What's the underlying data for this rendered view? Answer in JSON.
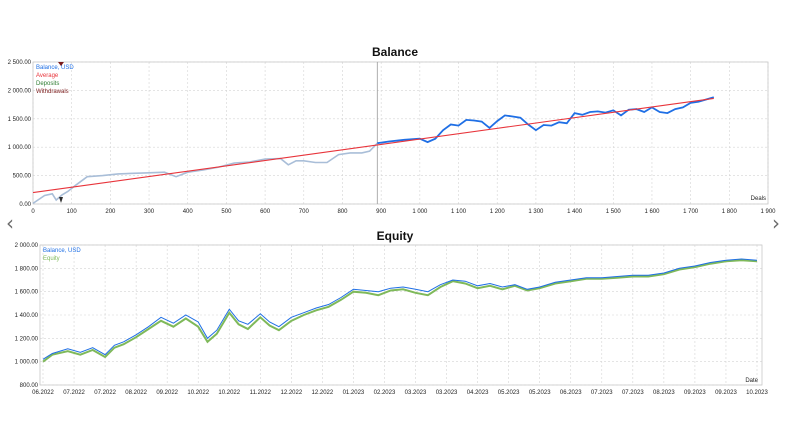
{
  "nav": {
    "prev_label": "‹",
    "next_label": "›"
  },
  "colors": {
    "balance": "#1f6fe5",
    "balance_faded": "#a9bed8",
    "average": "#e8343b",
    "equity": "#7fb95a",
    "withdrawal_marker": "#7a1a1a",
    "deposit_marker": "#2e7d32"
  },
  "chart_data": [
    {
      "type": "line",
      "title": "Balance",
      "xlabel": "Deals",
      "ylabel": "",
      "xlim": [
        0,
        1900
      ],
      "ylim": [
        0,
        2500
      ],
      "x_ticks": [
        "0",
        "100",
        "200",
        "300",
        "400",
        "500",
        "600",
        "700",
        "800",
        "900",
        "1 000",
        "1 100",
        "1 200",
        "1 300",
        "1 400",
        "1 500",
        "1 600",
        "1 700",
        "1 800",
        "1 900"
      ],
      "y_ticks": [
        "0.00",
        "500.00",
        "1 000.00",
        "1 500.00",
        "2 000.00",
        "2 500.00"
      ],
      "grid": true,
      "legend_position": "top-left",
      "legend": [
        "Balance, USD",
        "Average",
        "Deposits",
        "Withdrawals"
      ],
      "divider_x": 890,
      "series": [
        {
          "name": "Balance, USD",
          "x": [
            0,
            30,
            50,
            60,
            75,
            90,
            110,
            140,
            180,
            220,
            260,
            300,
            340,
            370,
            400,
            440,
            480,
            520,
            560,
            600,
            640,
            660,
            680,
            700,
            730,
            760,
            790,
            820,
            850,
            870,
            890,
            920,
            960,
            1000,
            1020,
            1040,
            1060,
            1080,
            1100,
            1120,
            1140,
            1160,
            1180,
            1200,
            1220,
            1240,
            1260,
            1280,
            1300,
            1320,
            1340,
            1360,
            1380,
            1400,
            1420,
            1440,
            1460,
            1480,
            1500,
            1520,
            1540,
            1560,
            1580,
            1600,
            1620,
            1640,
            1660,
            1680,
            1700,
            1720,
            1740,
            1760
          ],
          "y": [
            10,
            150,
            180,
            70,
            160,
            220,
            330,
            480,
            500,
            530,
            540,
            550,
            560,
            480,
            560,
            600,
            650,
            720,
            740,
            790,
            800,
            690,
            760,
            760,
            730,
            730,
            870,
            900,
            900,
            930,
            1070,
            1100,
            1130,
            1150,
            1090,
            1150,
            1300,
            1400,
            1380,
            1480,
            1470,
            1450,
            1340,
            1460,
            1560,
            1540,
            1520,
            1400,
            1300,
            1390,
            1380,
            1440,
            1420,
            1600,
            1570,
            1620,
            1630,
            1610,
            1650,
            1560,
            1660,
            1670,
            1620,
            1700,
            1620,
            1600,
            1670,
            1700,
            1780,
            1800,
            1840,
            1880
          ]
        },
        {
          "name": "Average",
          "x": [
            0,
            1760
          ],
          "y": [
            200,
            1860
          ]
        }
      ]
    },
    {
      "type": "line",
      "title": "Equity",
      "xlabel": "Date",
      "ylabel": "",
      "ylim": [
        800,
        2000
      ],
      "x_ticks": [
        "06.2022",
        "07.2022",
        "07.2022",
        "08.2022",
        "09.2022",
        "10.2022",
        "10.2022",
        "11.2022",
        "12.2022",
        "12.2022",
        "01.2023",
        "02.2023",
        "03.2023",
        "03.2023",
        "04.2023",
        "05.2023",
        "05.2023",
        "06.2023",
        "07.2023",
        "07.2023",
        "08.2023",
        "09.2023",
        "09.2023",
        "10.2023"
      ],
      "y_ticks": [
        "800.00",
        "1 000.00",
        "1 200.00",
        "1 400.00",
        "1 600.00",
        "1 800.00",
        "2 000.00"
      ],
      "grid": true,
      "legend_position": "top-left",
      "legend": [
        "Balance, USD",
        "Equity"
      ],
      "series": [
        {
          "name": "Balance, USD",
          "x": [
            0,
            0.3,
            0.8,
            1.2,
            1.6,
            2.0,
            2.3,
            2.6,
            3.0,
            3.4,
            3.8,
            4.2,
            4.6,
            5.0,
            5.3,
            5.6,
            6.0,
            6.3,
            6.6,
            7.0,
            7.3,
            7.6,
            8.0,
            8.4,
            8.8,
            9.2,
            9.6,
            10.0,
            10.4,
            10.8,
            11.2,
            11.6,
            12.0,
            12.4,
            12.8,
            13.2,
            13.6,
            14.0,
            14.4,
            14.8,
            15.2,
            15.6,
            16.0,
            16.5,
            17.0,
            17.5,
            18.0,
            18.5,
            19.0,
            19.5,
            20.0,
            20.5,
            21.0,
            21.5,
            22.0,
            22.5,
            23.0
          ],
          "y": [
            1020,
            1070,
            1110,
            1080,
            1120,
            1060,
            1140,
            1170,
            1230,
            1300,
            1380,
            1330,
            1400,
            1340,
            1200,
            1270,
            1450,
            1350,
            1320,
            1410,
            1340,
            1300,
            1380,
            1420,
            1460,
            1490,
            1550,
            1620,
            1610,
            1600,
            1630,
            1640,
            1620,
            1600,
            1660,
            1700,
            1690,
            1650,
            1670,
            1640,
            1660,
            1620,
            1640,
            1680,
            1700,
            1720,
            1720,
            1730,
            1740,
            1740,
            1760,
            1800,
            1820,
            1850,
            1870,
            1880,
            1870
          ]
        },
        {
          "name": "Equity",
          "x": [
            0,
            0.3,
            0.8,
            1.2,
            1.6,
            2.0,
            2.3,
            2.6,
            3.0,
            3.4,
            3.8,
            4.2,
            4.6,
            5.0,
            5.3,
            5.6,
            6.0,
            6.3,
            6.6,
            7.0,
            7.3,
            7.6,
            8.0,
            8.4,
            8.8,
            9.2,
            9.6,
            10.0,
            10.4,
            10.8,
            11.2,
            11.6,
            12.0,
            12.4,
            12.8,
            13.2,
            13.6,
            14.0,
            14.4,
            14.8,
            15.2,
            15.6,
            16.0,
            16.5,
            17.0,
            17.5,
            18.0,
            18.5,
            19.0,
            19.5,
            20.0,
            20.5,
            21.0,
            21.5,
            22.0,
            22.5,
            23.0
          ],
          "y": [
            1000,
            1060,
            1090,
            1060,
            1100,
            1040,
            1120,
            1150,
            1210,
            1280,
            1350,
            1300,
            1370,
            1300,
            1170,
            1240,
            1420,
            1320,
            1280,
            1380,
            1310,
            1270,
            1350,
            1400,
            1440,
            1470,
            1530,
            1600,
            1590,
            1570,
            1610,
            1620,
            1590,
            1570,
            1640,
            1690,
            1670,
            1630,
            1650,
            1620,
            1650,
            1610,
            1630,
            1670,
            1690,
            1710,
            1710,
            1720,
            1730,
            1730,
            1750,
            1790,
            1810,
            1840,
            1860,
            1870,
            1860
          ]
        }
      ]
    }
  ]
}
